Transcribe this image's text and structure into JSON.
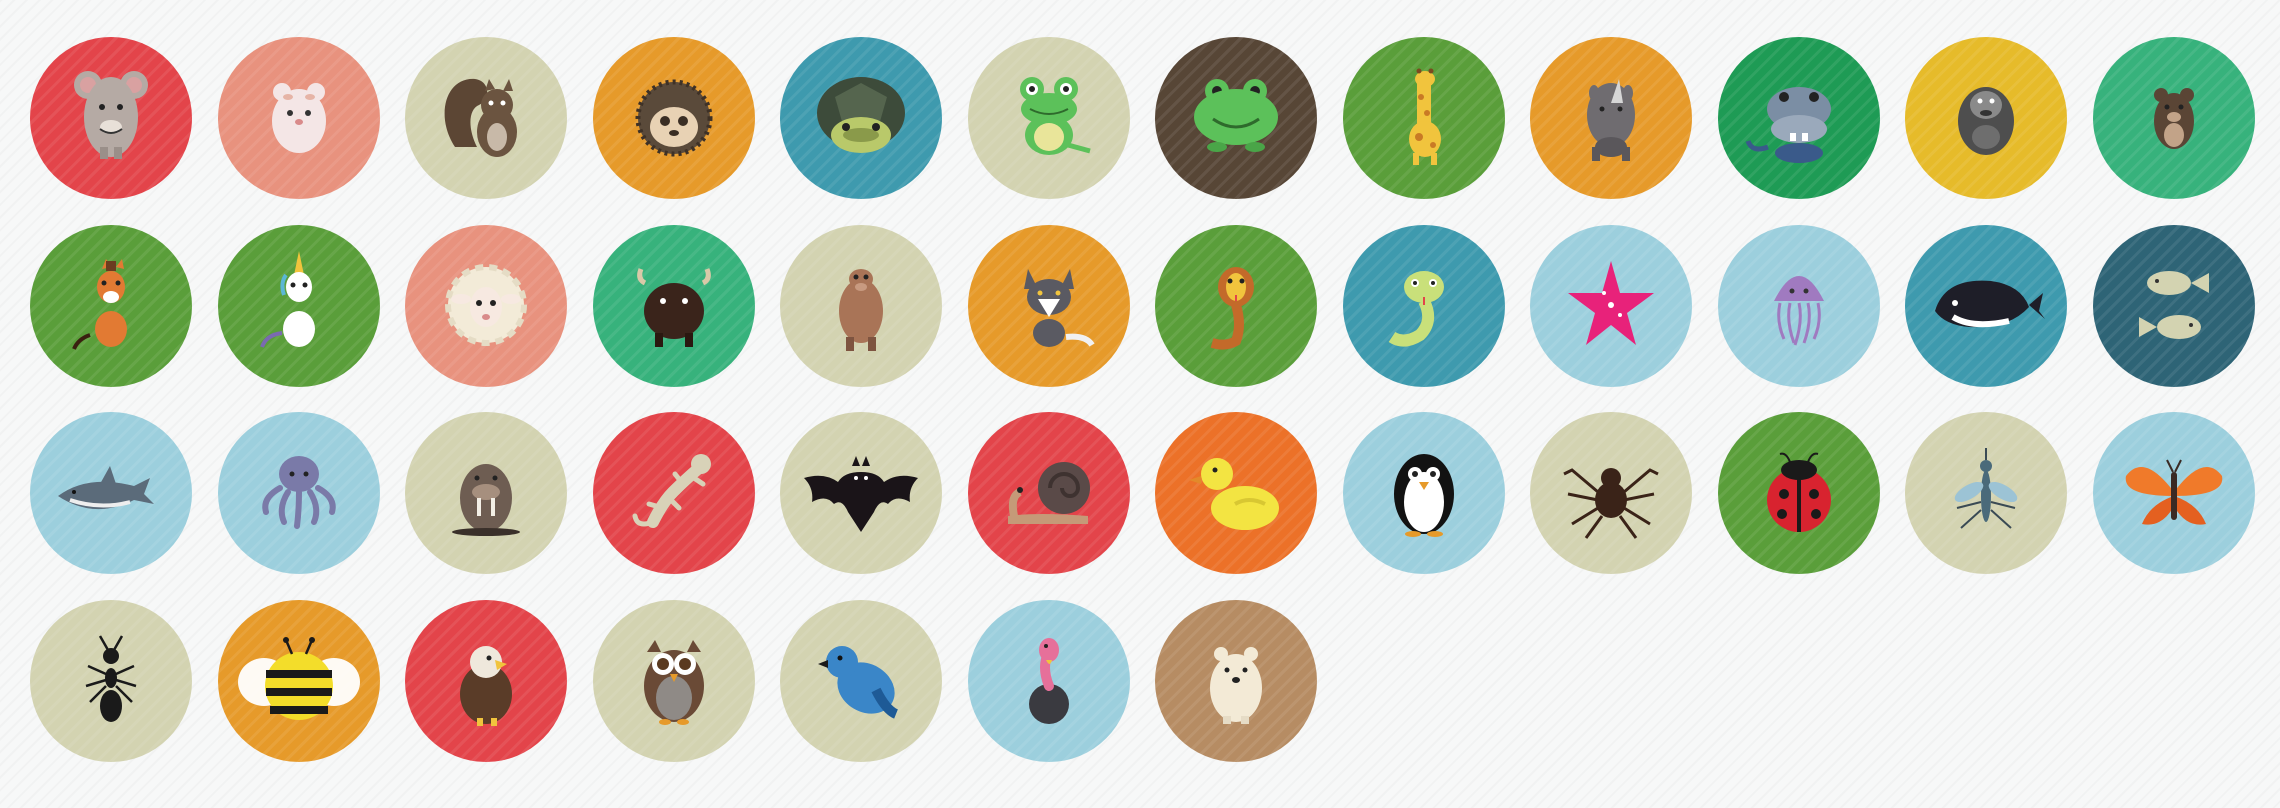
{
  "icons": [
    {
      "name": "mouse-icon",
      "bg": "#e3444a"
    },
    {
      "name": "hamster-icon",
      "bg": "#e8927e"
    },
    {
      "name": "squirrel-icon",
      "bg": "#d3d3b1"
    },
    {
      "name": "hedgehog-icon",
      "bg": "#e69a2a"
    },
    {
      "name": "turtle-icon",
      "bg": "#3e9aae"
    },
    {
      "name": "frog-icon",
      "bg": "#d3d3b1"
    },
    {
      "name": "toad-icon",
      "bg": "#574636"
    },
    {
      "name": "giraffe-icon",
      "bg": "#5a9e3a"
    },
    {
      "name": "rhino-icon",
      "bg": "#e69a2a"
    },
    {
      "name": "hippo-icon",
      "bg": "#1e9b55"
    },
    {
      "name": "gorilla-icon",
      "bg": "#e6bb2a"
    },
    {
      "name": "bear-icon",
      "bg": "#37b27c"
    },
    {
      "name": "horse-icon",
      "bg": "#5a9e3a"
    },
    {
      "name": "unicorn-icon",
      "bg": "#5a9e3a"
    },
    {
      "name": "sheep-icon",
      "bg": "#e8927e"
    },
    {
      "name": "bison-icon",
      "bg": "#37b27c"
    },
    {
      "name": "camel-icon",
      "bg": "#d3d3b1"
    },
    {
      "name": "wolf-icon",
      "bg": "#e69a2a"
    },
    {
      "name": "cobra-icon",
      "bg": "#5a9e3a"
    },
    {
      "name": "snake-icon",
      "bg": "#3e9aae"
    },
    {
      "name": "starfish-icon",
      "bg": "#9ccfdd"
    },
    {
      "name": "jellyfish-icon",
      "bg": "#9ccfdd"
    },
    {
      "name": "whale-icon",
      "bg": "#3e9aae"
    },
    {
      "name": "fish-icon",
      "bg": "#2e6476"
    },
    {
      "name": "shark-icon",
      "bg": "#9ccfdd"
    },
    {
      "name": "octopus-icon",
      "bg": "#9ccfdd"
    },
    {
      "name": "walrus-icon",
      "bg": "#d3d3b1"
    },
    {
      "name": "gecko-icon",
      "bg": "#e3444a"
    },
    {
      "name": "bat-icon",
      "bg": "#d3d3b1"
    },
    {
      "name": "snail-icon",
      "bg": "#e3444a"
    },
    {
      "name": "duck-icon",
      "bg": "#ec7128"
    },
    {
      "name": "penguin-icon",
      "bg": "#9ccfdd"
    },
    {
      "name": "spider-icon",
      "bg": "#d3d3b1"
    },
    {
      "name": "ladybug-icon",
      "bg": "#5a9e3a"
    },
    {
      "name": "mosquito-icon",
      "bg": "#d3d3b1"
    },
    {
      "name": "butterfly-icon",
      "bg": "#9ccfdd"
    },
    {
      "name": "ant-icon",
      "bg": "#d3d3b1"
    },
    {
      "name": "bee-icon",
      "bg": "#e69a2a"
    },
    {
      "name": "eagle-icon",
      "bg": "#e3444a"
    },
    {
      "name": "owl-icon",
      "bg": "#d3d3b1"
    },
    {
      "name": "bluebird-icon",
      "bg": "#d3d3b1"
    },
    {
      "name": "vulture-icon",
      "bg": "#9ccfdd"
    },
    {
      "name": "polar-bear-icon",
      "bg": "#b68c63"
    }
  ]
}
